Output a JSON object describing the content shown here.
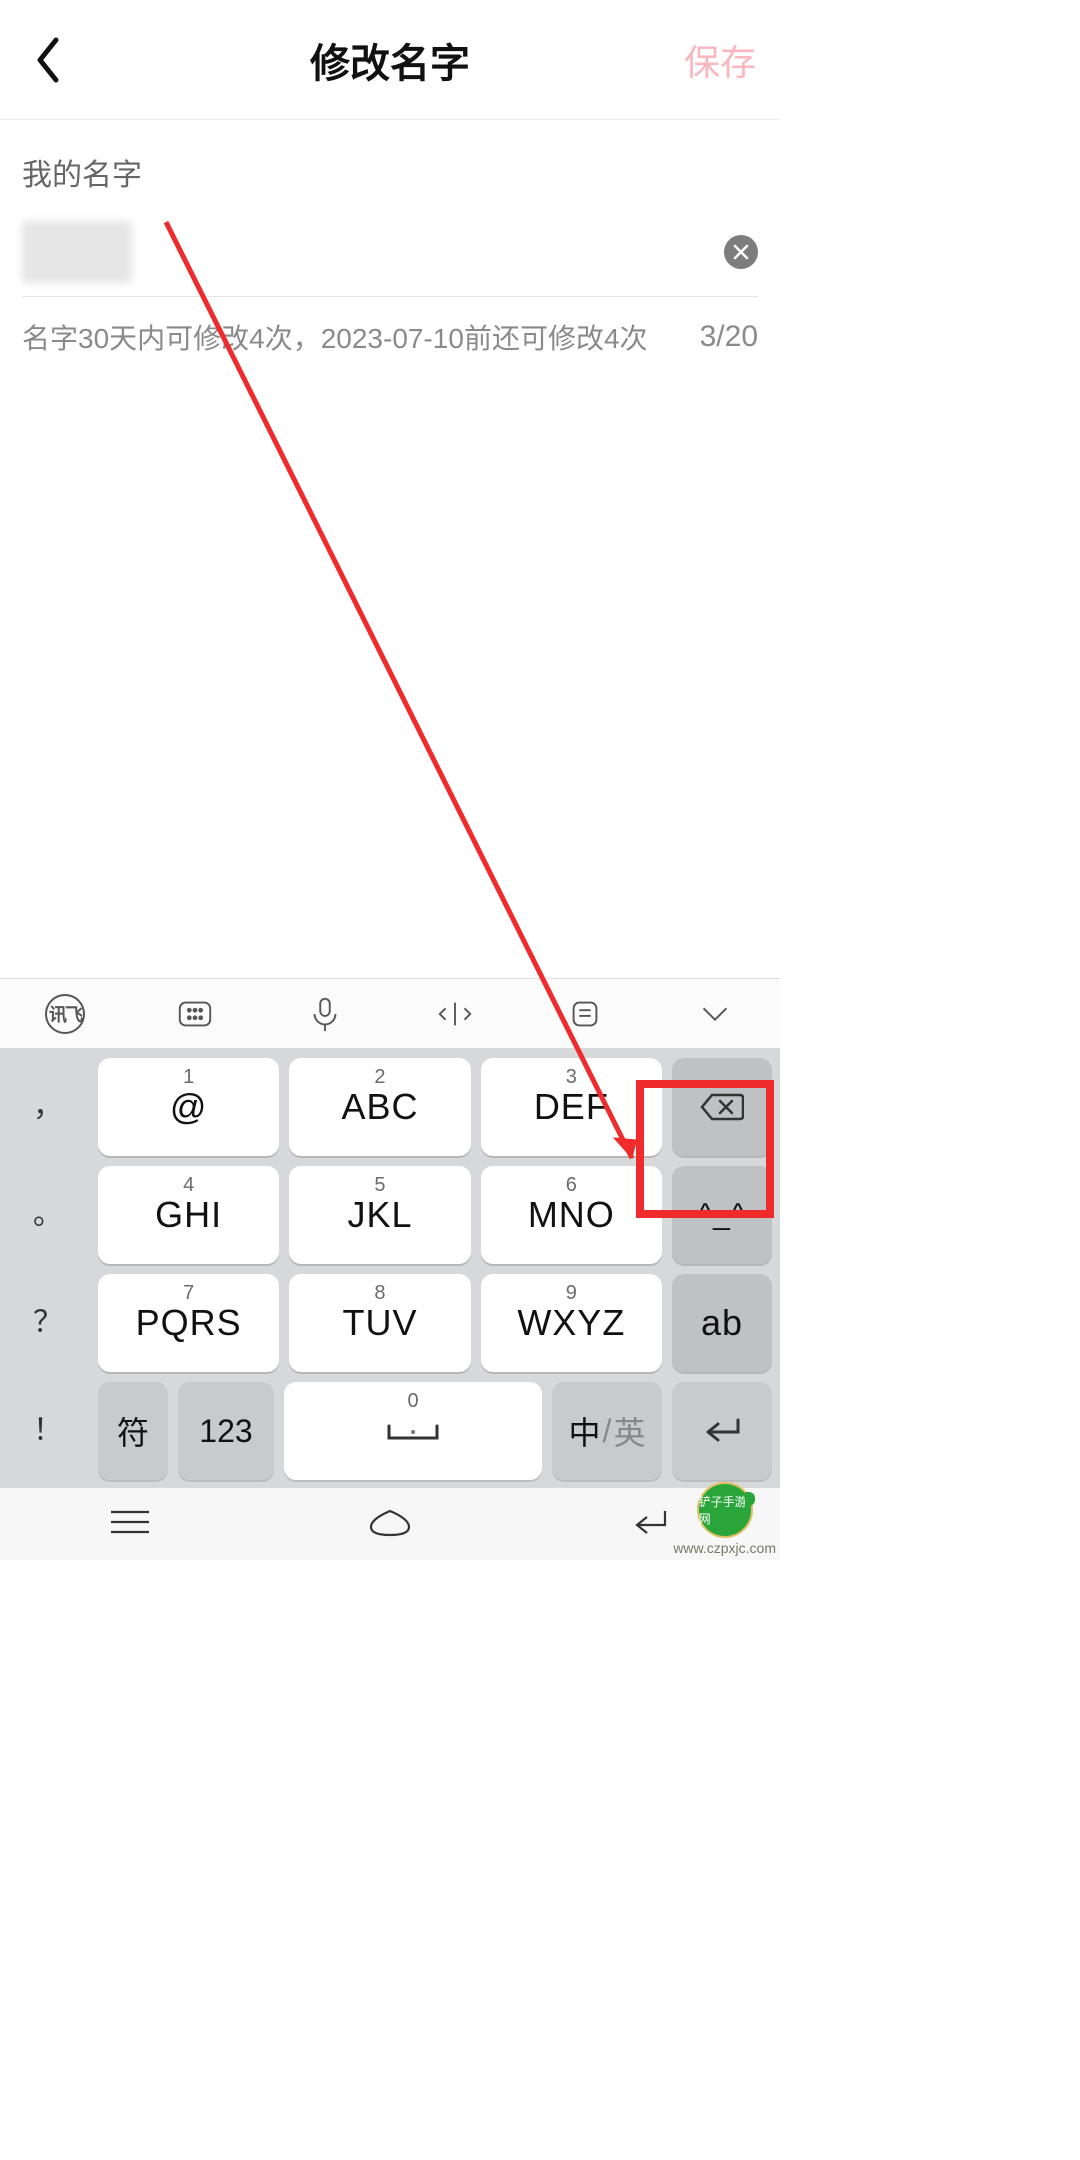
{
  "header": {
    "title": "修改名字",
    "save_label": "保存"
  },
  "form": {
    "label": "我的名字",
    "name_value": "",
    "hint": "名字30天内可修改4次，2023-07-10前还可修改4次",
    "counter": "3/20"
  },
  "keyboard": {
    "toolbar": {
      "brand": "讯飞",
      "icons": [
        "keyboard-settings-icon",
        "mic-icon",
        "cursor-move-icon",
        "clipboard-icon",
        "collapse-icon"
      ]
    },
    "side_left": [
      "，",
      "。",
      "？",
      "！"
    ],
    "keys": [
      {
        "num": "1",
        "main": "@"
      },
      {
        "num": "2",
        "main": "ABC"
      },
      {
        "num": "3",
        "main": "DEF"
      },
      {
        "num": "4",
        "main": "GHI"
      },
      {
        "num": "5",
        "main": "JKL"
      },
      {
        "num": "6",
        "main": "MNO"
      },
      {
        "num": "7",
        "main": "PQRS"
      },
      {
        "num": "8",
        "main": "TUV"
      },
      {
        "num": "9",
        "main": "WXYZ"
      }
    ],
    "right_col": {
      "backspace": "⌫",
      "emoji": "^_^",
      "ab": "ab"
    },
    "bottom": {
      "symbol": "符",
      "numeric": "123",
      "space_num": "0",
      "lang_zh": "中",
      "lang_sep": "/",
      "lang_en": "英"
    }
  },
  "watermark": {
    "name": "铲子手游网",
    "url": "www.czpxjc.com"
  }
}
